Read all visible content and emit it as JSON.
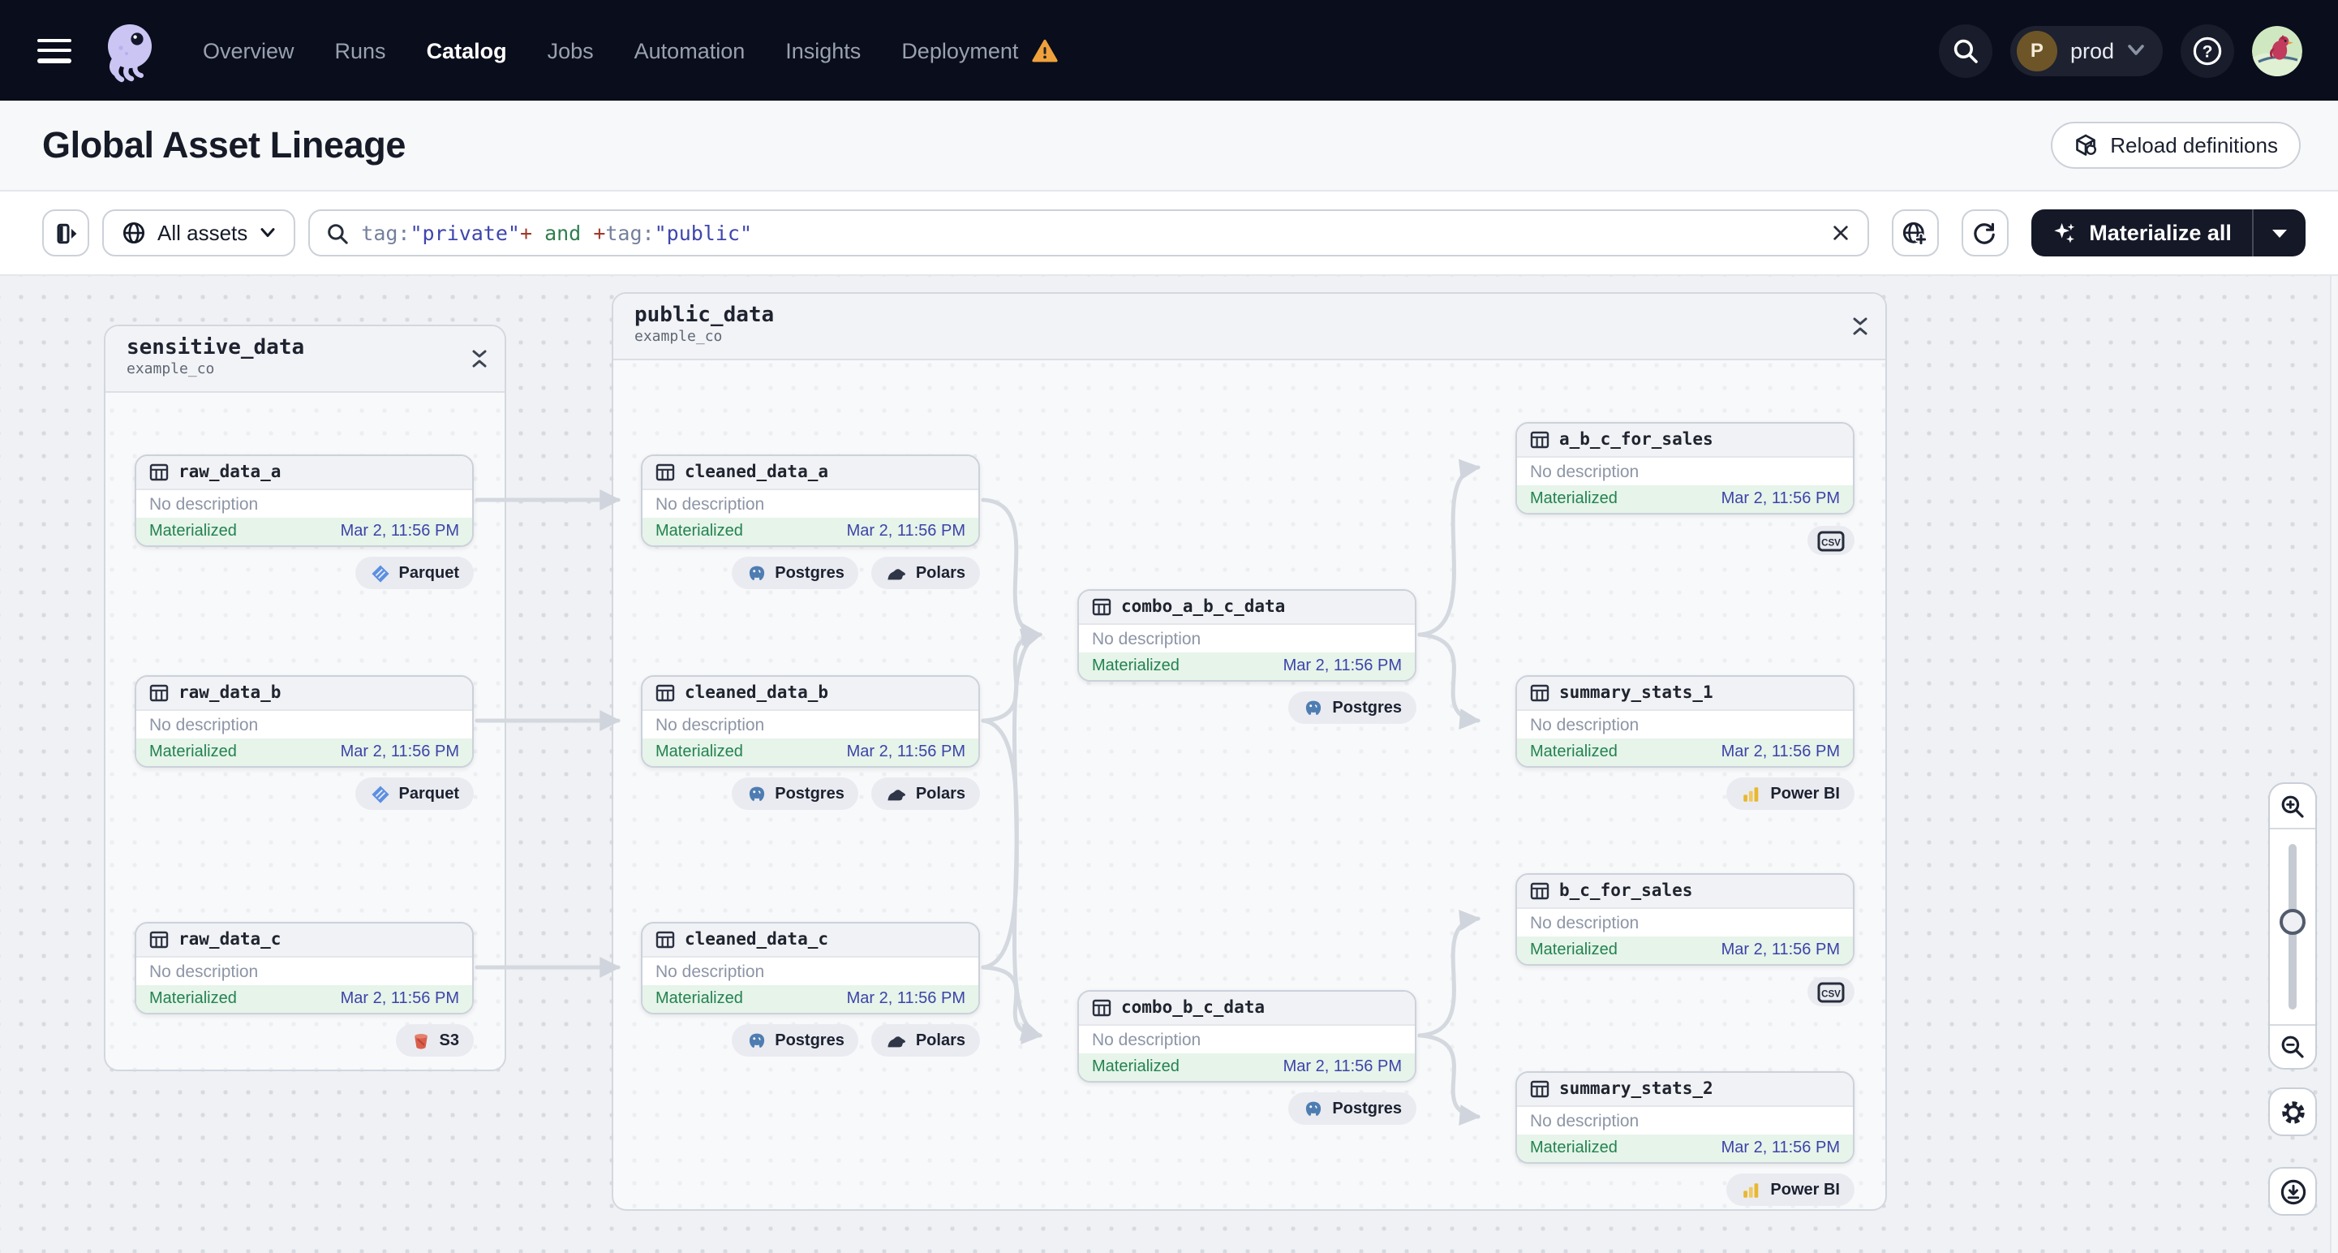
{
  "nav": {
    "brand_icon": "dagster-octopus-logo",
    "items": [
      {
        "label": "Overview"
      },
      {
        "label": "Runs"
      },
      {
        "label": "Catalog",
        "active": true
      },
      {
        "label": "Jobs"
      },
      {
        "label": "Automation"
      },
      {
        "label": "Insights"
      },
      {
        "label": "Deployment",
        "warning": true
      }
    ],
    "environment": {
      "avatar_initial": "P",
      "name": "prod"
    }
  },
  "header": {
    "title": "Global Asset Lineage",
    "reload_button_label": "Reload definitions"
  },
  "toolbar": {
    "scope_button_label": "All assets",
    "search_query": "tag:\"private\"+ and +tag:\"public\"",
    "query_tokens": [
      {
        "text": "tag:",
        "color": "#75809c"
      },
      {
        "text": "\"private\"",
        "color": "#3f46ad"
      },
      {
        "text": "+",
        "color": "#a03a2c"
      },
      {
        "text": " and ",
        "color": "#2f7d4f"
      },
      {
        "text": "+",
        "color": "#a03a2c"
      },
      {
        "text": "tag:",
        "color": "#75809c"
      },
      {
        "text": "\"public\"",
        "color": "#3f46ad"
      }
    ],
    "materialize_button_label": "Materialize all"
  },
  "graph": {
    "groups": [
      {
        "name": "sensitive_data",
        "location": "example_co"
      },
      {
        "name": "public_data",
        "location": "example_co"
      }
    ],
    "nodes": [
      {
        "label": "raw_data_a",
        "description": "No description",
        "status": "Materialized",
        "timestamp": "Mar 2, 11:56 PM",
        "tags": [
          {
            "label": "Parquet",
            "icon": "parquet-icon"
          }
        ]
      },
      {
        "label": "raw_data_b",
        "description": "No description",
        "status": "Materialized",
        "timestamp": "Mar 2, 11:56 PM",
        "tags": [
          {
            "label": "Parquet",
            "icon": "parquet-icon"
          }
        ]
      },
      {
        "label": "raw_data_c",
        "description": "No description",
        "status": "Materialized",
        "timestamp": "Mar 2, 11:56 PM",
        "tags": [
          {
            "label": "S3",
            "icon": "s3-bucket-icon"
          }
        ]
      },
      {
        "label": "cleaned_data_a",
        "description": "No description",
        "status": "Materialized",
        "timestamp": "Mar 2, 11:56 PM",
        "tags": [
          {
            "label": "Postgres",
            "icon": "postgres-icon"
          },
          {
            "label": "Polars",
            "icon": "polars-icon"
          }
        ]
      },
      {
        "label": "cleaned_data_b",
        "description": "No description",
        "status": "Materialized",
        "timestamp": "Mar 2, 11:56 PM",
        "tags": [
          {
            "label": "Postgres",
            "icon": "postgres-icon"
          },
          {
            "label": "Polars",
            "icon": "polars-icon"
          }
        ]
      },
      {
        "label": "cleaned_data_c",
        "description": "No description",
        "status": "Materialized",
        "timestamp": "Mar 2, 11:56 PM",
        "tags": [
          {
            "label": "Postgres",
            "icon": "postgres-icon"
          },
          {
            "label": "Polars",
            "icon": "polars-icon"
          }
        ]
      },
      {
        "label": "combo_a_b_c_data",
        "description": "No description",
        "status": "Materialized",
        "timestamp": "Mar 2, 11:56 PM",
        "tags": [
          {
            "label": "Postgres",
            "icon": "postgres-icon"
          }
        ]
      },
      {
        "label": "combo_b_c_data",
        "description": "No description",
        "status": "Materialized",
        "timestamp": "Mar 2, 11:56 PM",
        "tags": [
          {
            "label": "Postgres",
            "icon": "postgres-icon"
          }
        ]
      },
      {
        "label": "a_b_c_for_sales",
        "description": "No description",
        "status": "Materialized",
        "timestamp": "Mar 2, 11:56 PM",
        "tags": [
          {
            "label": "",
            "icon": "csv-icon"
          }
        ]
      },
      {
        "label": "summary_stats_1",
        "description": "No description",
        "status": "Materialized",
        "timestamp": "Mar 2, 11:56 PM",
        "tags": [
          {
            "label": "Power BI",
            "icon": "powerbi-icon"
          }
        ]
      },
      {
        "label": "b_c_for_sales",
        "description": "No description",
        "status": "Materialized",
        "timestamp": "Mar 2, 11:56 PM",
        "tags": [
          {
            "label": "",
            "icon": "csv-icon"
          }
        ]
      },
      {
        "label": "summary_stats_2",
        "description": "No description",
        "status": "Materialized",
        "timestamp": "Mar 2, 11:56 PM",
        "tags": [
          {
            "label": "Power BI",
            "icon": "powerbi-icon"
          }
        ]
      }
    ],
    "edges": [
      [
        "raw_data_a",
        "cleaned_data_a"
      ],
      [
        "raw_data_b",
        "cleaned_data_b"
      ],
      [
        "raw_data_c",
        "cleaned_data_c"
      ],
      [
        "cleaned_data_a",
        "combo_a_b_c_data"
      ],
      [
        "cleaned_data_b",
        "combo_a_b_c_data"
      ],
      [
        "cleaned_data_c",
        "combo_a_b_c_data"
      ],
      [
        "cleaned_data_b",
        "combo_b_c_data"
      ],
      [
        "cleaned_data_c",
        "combo_b_c_data"
      ],
      [
        "combo_a_b_c_data",
        "a_b_c_for_sales"
      ],
      [
        "combo_a_b_c_data",
        "summary_stats_1"
      ],
      [
        "combo_b_c_data",
        "b_c_for_sales"
      ],
      [
        "combo_b_c_data",
        "summary_stats_2"
      ]
    ]
  },
  "colors": {
    "nav_bg": "#0a0d1b",
    "button_dark": "#141827",
    "materialized_green": "#23824f",
    "timestamp_indigo": "#3d43a8",
    "edge_gray": "#d4d8df",
    "warning_orange": "#f0a13c",
    "canvas_bg": "#eff1f4"
  }
}
